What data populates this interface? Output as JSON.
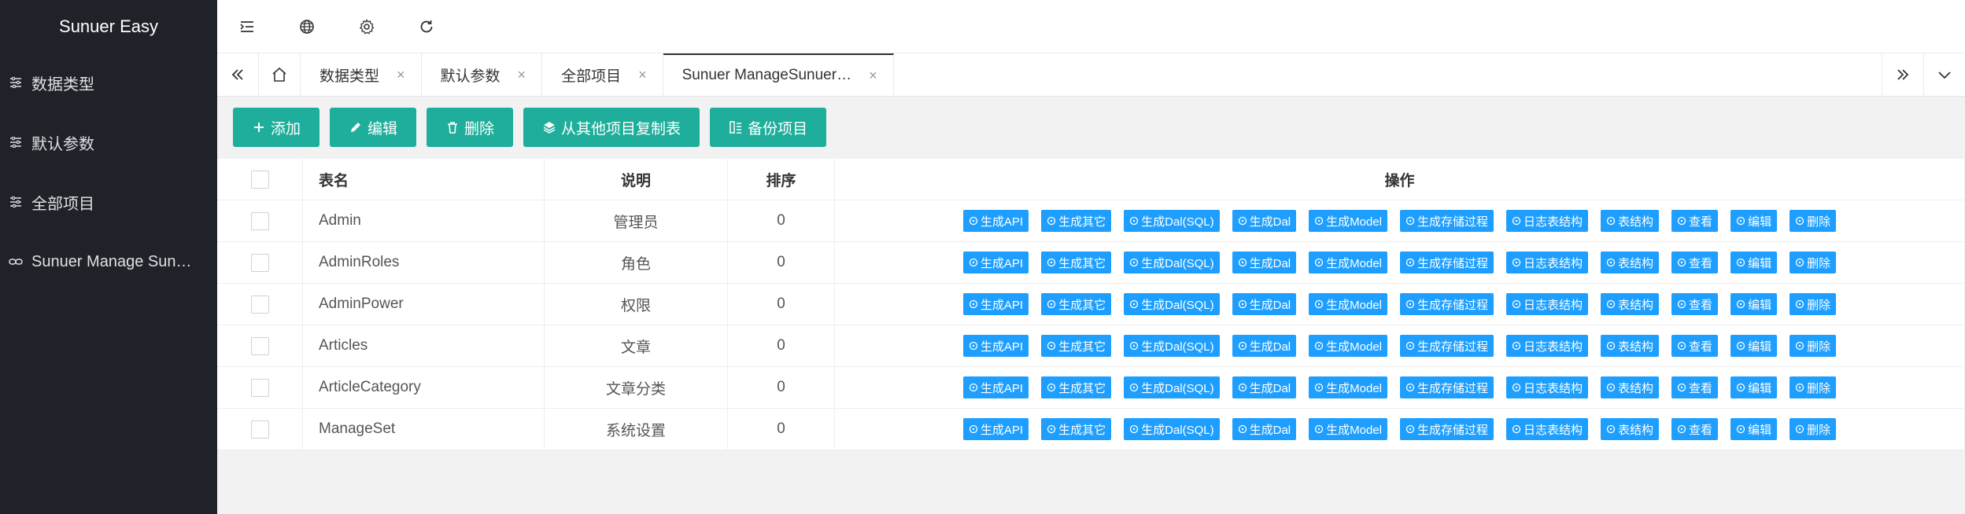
{
  "app": {
    "title": "Sunuer Easy"
  },
  "sidebar": {
    "items": [
      {
        "label": "数据类型",
        "icon": "sliders-icon"
      },
      {
        "label": "默认参数",
        "icon": "sliders-icon"
      },
      {
        "label": "全部项目",
        "icon": "sliders-icon"
      },
      {
        "label": "Sunuer Manage Sun…",
        "icon": "link-icon"
      }
    ]
  },
  "header": {
    "icons": [
      "menu-fold-icon",
      "globe-icon",
      "gear-icon",
      "refresh-icon"
    ]
  },
  "tabs": {
    "items": [
      {
        "label": "数据类型",
        "close": "×"
      },
      {
        "label": "默认参数",
        "close": "×"
      },
      {
        "label": "全部项目",
        "close": "×"
      },
      {
        "label": "Sunuer ManageSunuer…",
        "close": "×"
      }
    ]
  },
  "toolbar": {
    "add": "添加",
    "edit": "编辑",
    "delete": "删除",
    "copy": "从其他项目复制表",
    "backup": "备份项目"
  },
  "table": {
    "headers": {
      "name": "表名",
      "desc": "说明",
      "sort": "排序",
      "ops": "操作"
    },
    "op_labels": [
      "生成API",
      "生成其它",
      "生成Dal(SQL)",
      "生成Dal",
      "生成Model",
      "生成存储过程",
      "日志表结构",
      "表结构",
      "查看",
      "编辑",
      "删除"
    ],
    "rows": [
      {
        "name": "Admin",
        "desc": "管理员",
        "sort": "0"
      },
      {
        "name": "AdminRoles",
        "desc": "角色",
        "sort": "0"
      },
      {
        "name": "AdminPower",
        "desc": "权限",
        "sort": "0"
      },
      {
        "name": "Articles",
        "desc": "文章",
        "sort": "0"
      },
      {
        "name": "ArticleCategory",
        "desc": "文章分类",
        "sort": "0"
      },
      {
        "name": "ManageSet",
        "desc": "系统设置",
        "sort": "0"
      }
    ]
  },
  "colors": {
    "sidebar_bg": "#20222a",
    "toolbar_btn": "#1fae9b",
    "op_btn": "#1e9fff"
  }
}
